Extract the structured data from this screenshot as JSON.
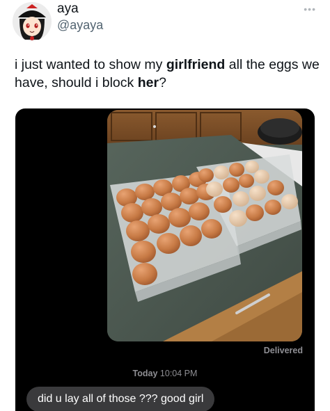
{
  "author": {
    "display_name": "aya",
    "handle": "@ayaya",
    "more_icon": "ellipsis-icon"
  },
  "tweet": {
    "part1": "i just wanted to show my ",
    "bold1": "girlfriend",
    "part2": " all the eggs we have, should i block ",
    "bold2": "her",
    "part3": "?"
  },
  "imessage": {
    "photo": "eggs-in-cartons-photo",
    "delivered_label": "Delivered",
    "timestamp_day": "Today",
    "timestamp_time": "10:04 PM",
    "incoming_message": "did u lay all of those ??? good girl"
  },
  "colors": {
    "text": "#0f1419",
    "secondary_text": "#536471",
    "media_background": "#000000",
    "bubble": "#3a3a3c"
  }
}
